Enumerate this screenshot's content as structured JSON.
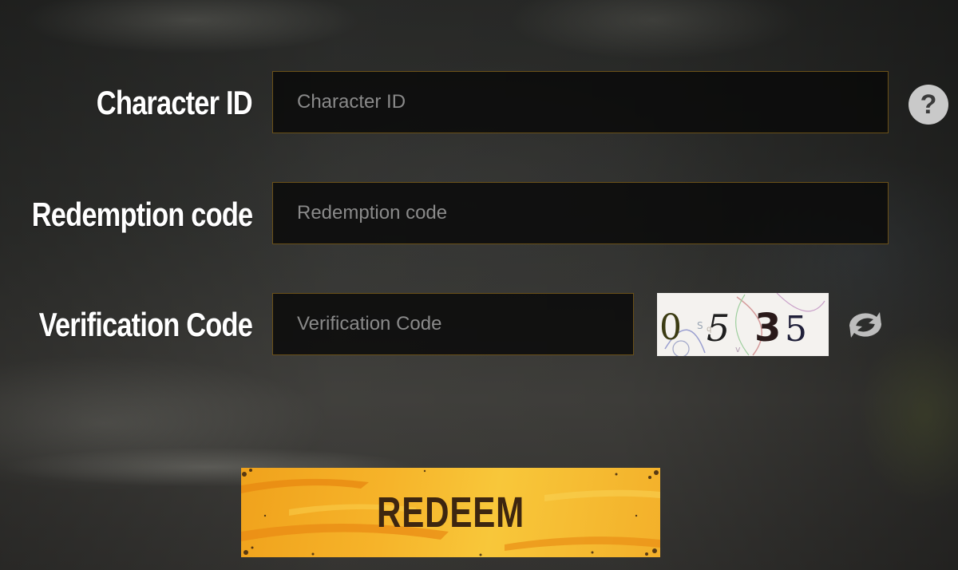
{
  "form": {
    "character_id": {
      "label": "Character ID",
      "placeholder": "Character ID",
      "value": ""
    },
    "redemption_code": {
      "label": "Redemption code",
      "placeholder": "Redemption code",
      "value": ""
    },
    "verification_code": {
      "label": "Verification Code",
      "placeholder": "Verification Code",
      "value": ""
    },
    "help_icon": "?",
    "captcha": {
      "text": "0535",
      "chars": [
        "0",
        "5",
        "3",
        "5"
      ]
    },
    "refresh_icon": "refresh-icon",
    "redeem_button": "REDEEM"
  },
  "colors": {
    "field_border": "#6b5118",
    "button_yellow": "#f6b42a",
    "button_text": "#3d2610",
    "label": "#ffffff"
  }
}
